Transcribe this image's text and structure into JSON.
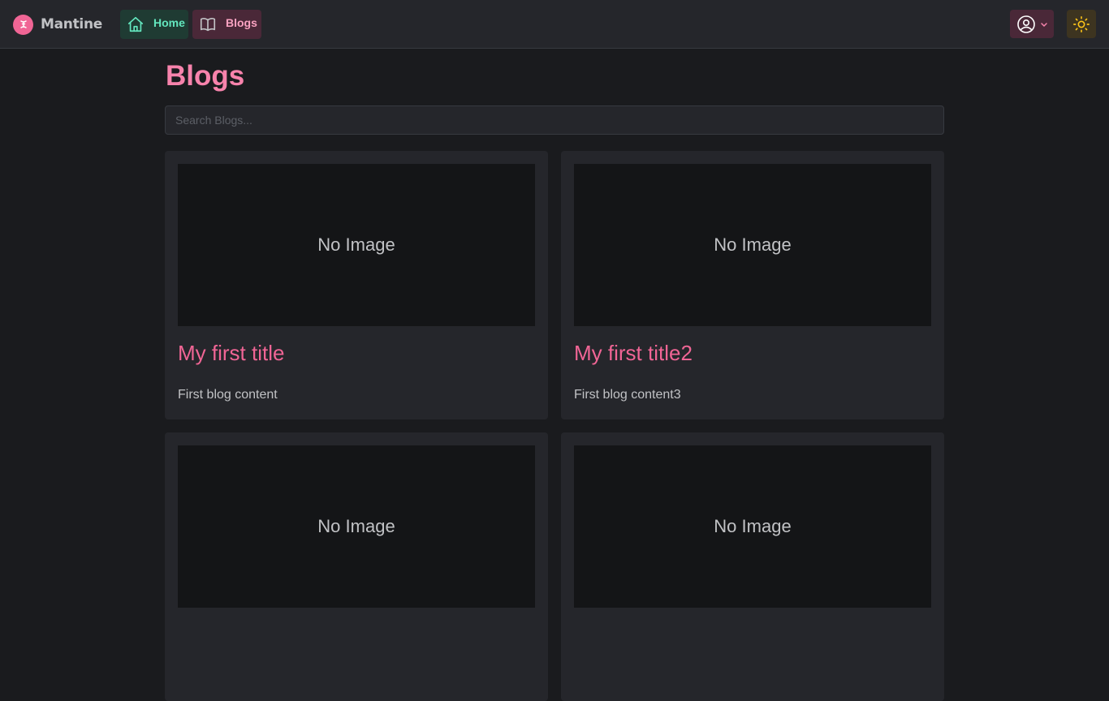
{
  "header": {
    "brand": "Mantine",
    "nav": [
      {
        "label": "Home",
        "icon": "home-icon"
      },
      {
        "label": "Blogs",
        "icon": "book-icon"
      }
    ],
    "user_menu_icon": "user-circle-icon",
    "theme_toggle_icon": "sun-icon"
  },
  "page": {
    "title": "Blogs",
    "search_placeholder": "Search Blogs..."
  },
  "blogs": [
    {
      "image_text": "No Image",
      "title": "My first title",
      "content": "First blog content"
    },
    {
      "image_text": "No Image",
      "title": "My first title2",
      "content": "First blog content3"
    },
    {
      "image_text": "No Image",
      "title": "",
      "content": ""
    },
    {
      "image_text": "No Image",
      "title": "",
      "content": ""
    }
  ],
  "colors": {
    "accent_pink": "#f06595",
    "accent_teal": "#63e6be",
    "sun_yellow": "#fcc419",
    "background": "#1a1b1e",
    "surface": "#25262b"
  }
}
